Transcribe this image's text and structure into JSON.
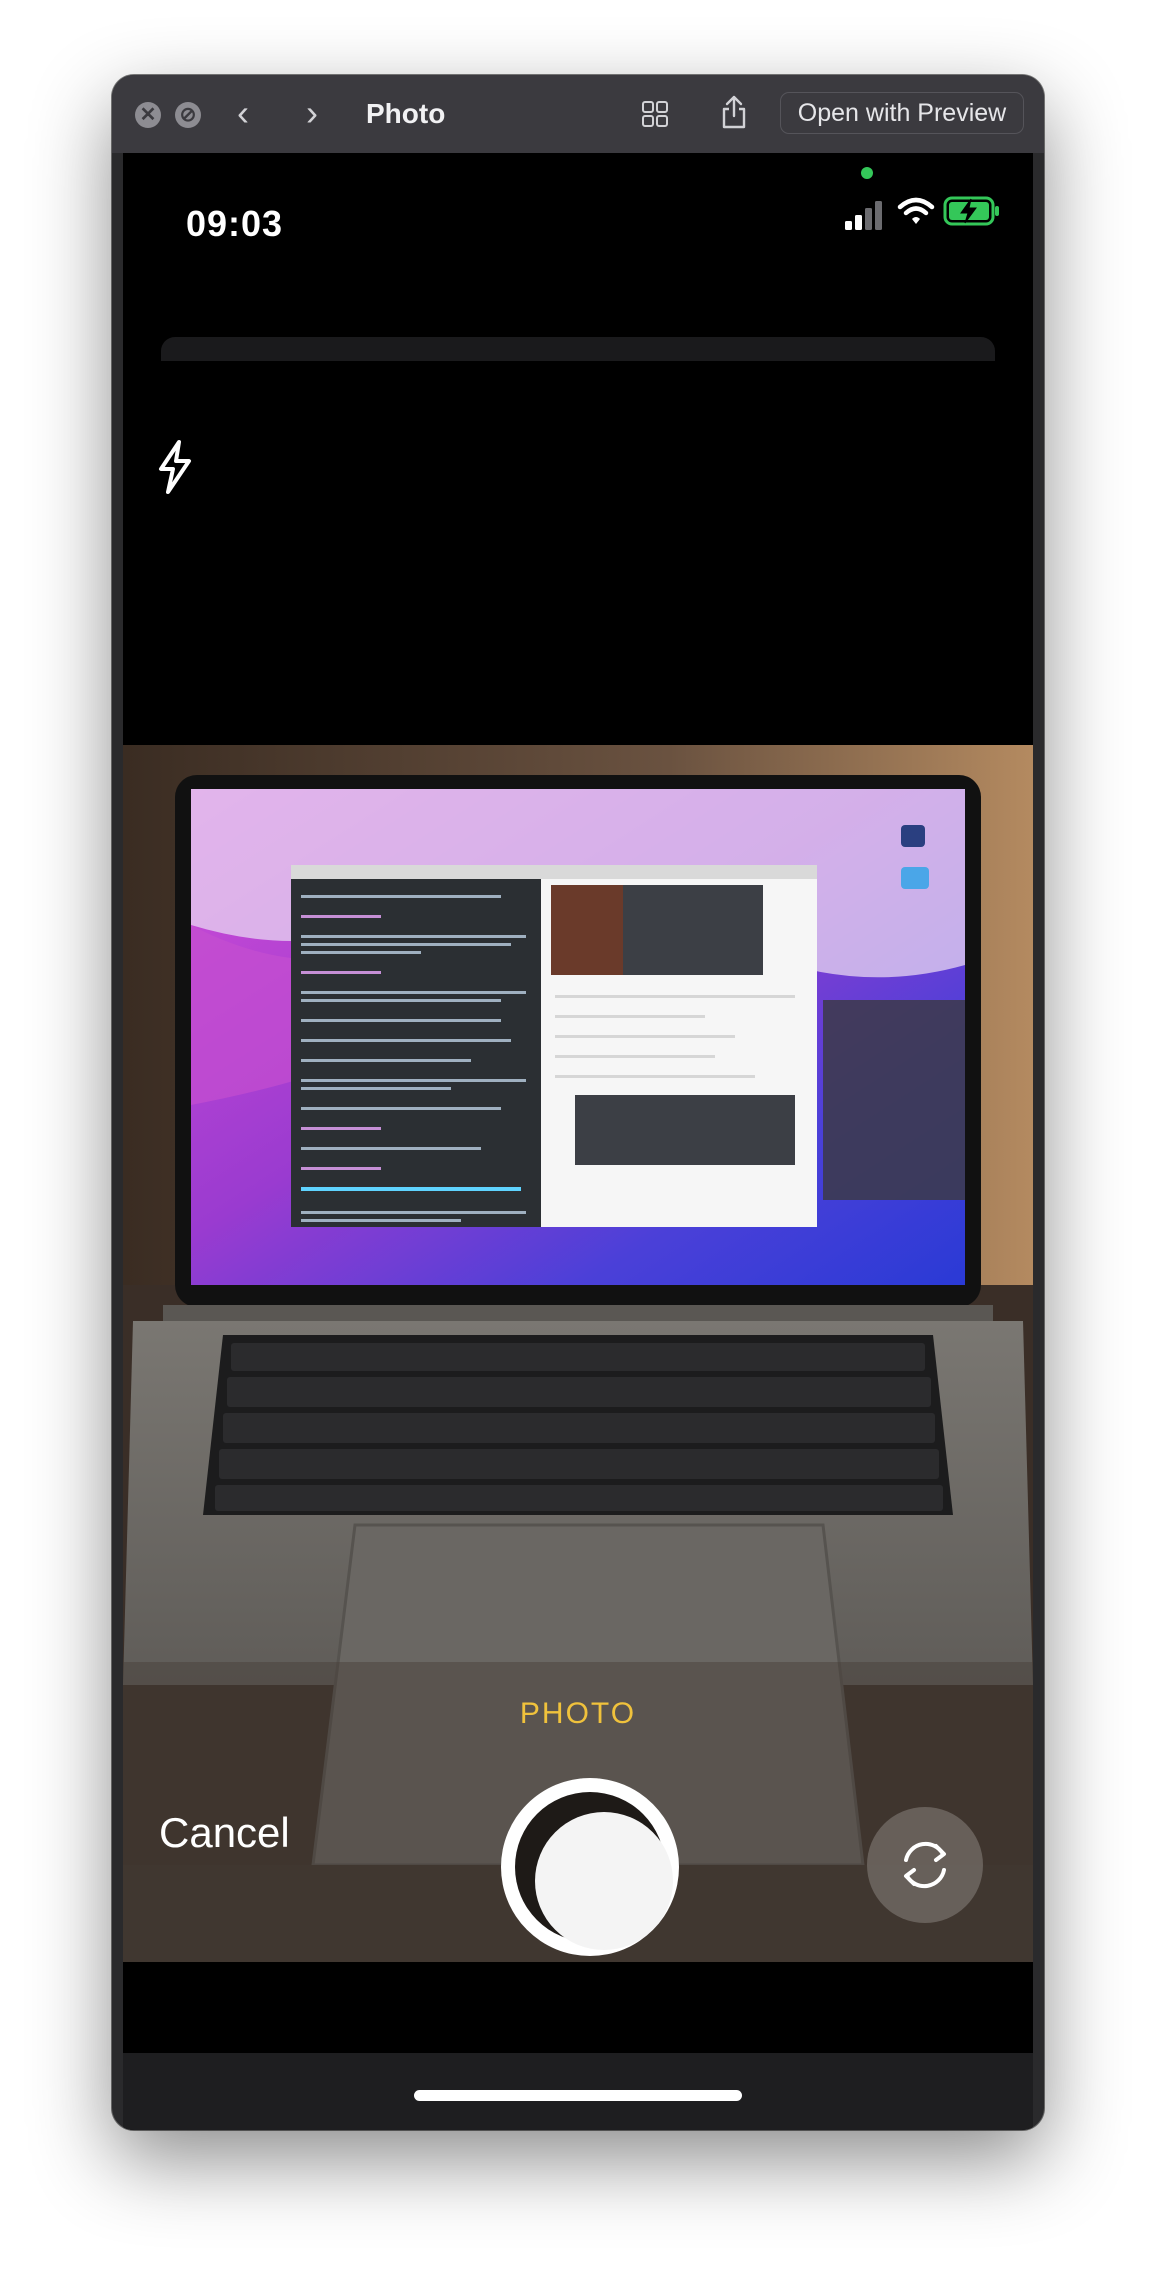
{
  "window": {
    "title": "Photo",
    "open_with_label": "Open with Preview"
  },
  "status_bar": {
    "time": "09:03"
  },
  "camera": {
    "mode_label": "PHOTO",
    "cancel_label": "Cancel"
  },
  "icons": {
    "close": "close-icon",
    "stop": "stop-icon",
    "back": "chevron-left-icon",
    "forward": "chevron-right-icon",
    "grid": "grid-icon",
    "share": "share-icon",
    "flash": "flash-icon",
    "flip": "camera-flip-icon",
    "signal": "cellular-signal-icon",
    "wifi": "wifi-icon",
    "battery": "battery-charging-icon"
  },
  "colors": {
    "mode_accent": "#f0c23c",
    "battery_green": "#34c759",
    "privacy_dot": "#34c759"
  }
}
